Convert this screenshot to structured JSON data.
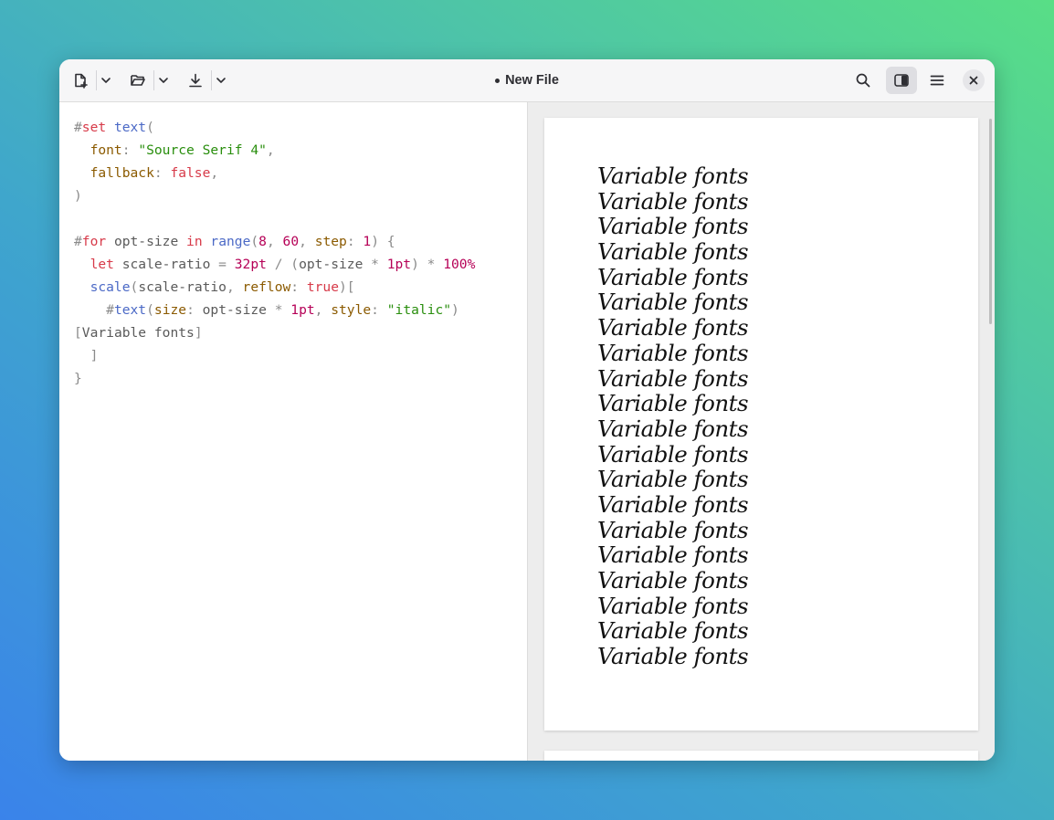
{
  "window": {
    "title": "New File",
    "unsaved_indicator": true
  },
  "toolbar": {
    "left_buttons": [
      {
        "icon": "new-file-icon"
      },
      {
        "icon": "chevron-down-icon"
      },
      {
        "icon": "open-folder-icon"
      },
      {
        "icon": "chevron-down-icon"
      },
      {
        "icon": "download-icon"
      },
      {
        "icon": "chevron-down-icon"
      }
    ],
    "right_buttons": [
      {
        "icon": "search-icon"
      },
      {
        "icon": "split-view-icon",
        "active": true
      },
      {
        "icon": "hamburger-menu-icon"
      },
      {
        "icon": "close-icon"
      }
    ]
  },
  "editor": {
    "lines": [
      [
        [
          "hash",
          "#"
        ],
        [
          "kw",
          "set"
        ],
        [
          "sp",
          " "
        ],
        [
          "fn",
          "text"
        ],
        [
          "punc",
          "("
        ]
      ],
      [
        [
          "sp",
          "  "
        ],
        [
          "arg",
          "font"
        ],
        [
          "punc",
          ": "
        ],
        [
          "str",
          "\"Source Serif 4\""
        ],
        [
          "punc",
          ","
        ]
      ],
      [
        [
          "sp",
          "  "
        ],
        [
          "arg",
          "fallback"
        ],
        [
          "punc",
          ": "
        ],
        [
          "kw",
          "false"
        ],
        [
          "punc",
          ","
        ]
      ],
      [
        [
          "punc",
          ")"
        ]
      ],
      [],
      [
        [
          "hash",
          "#"
        ],
        [
          "kw",
          "for"
        ],
        [
          "sp",
          " "
        ],
        [
          "var",
          "opt-size"
        ],
        [
          "sp",
          " "
        ],
        [
          "kw",
          "in"
        ],
        [
          "sp",
          " "
        ],
        [
          "fn",
          "range"
        ],
        [
          "punc",
          "("
        ],
        [
          "num",
          "8"
        ],
        [
          "punc",
          ", "
        ],
        [
          "num",
          "60"
        ],
        [
          "punc",
          ", "
        ],
        [
          "arg",
          "step"
        ],
        [
          "punc",
          ": "
        ],
        [
          "num",
          "1"
        ],
        [
          "punc",
          ") {"
        ]
      ],
      [
        [
          "sp",
          "  "
        ],
        [
          "kw",
          "let"
        ],
        [
          "sp",
          " "
        ],
        [
          "var",
          "scale-ratio"
        ],
        [
          "punc",
          " = "
        ],
        [
          "num",
          "32pt"
        ],
        [
          "punc",
          " / ("
        ],
        [
          "var",
          "opt-size"
        ],
        [
          "punc",
          " * "
        ],
        [
          "num",
          "1pt"
        ],
        [
          "punc",
          ") * "
        ],
        [
          "num",
          "100%"
        ]
      ],
      [
        [
          "sp",
          "  "
        ],
        [
          "fn",
          "scale"
        ],
        [
          "punc",
          "("
        ],
        [
          "var",
          "scale-ratio"
        ],
        [
          "punc",
          ", "
        ],
        [
          "arg",
          "reflow"
        ],
        [
          "punc",
          ": "
        ],
        [
          "kw",
          "true"
        ],
        [
          "punc",
          ")["
        ]
      ],
      [
        [
          "sp",
          "    "
        ],
        [
          "hash",
          "#"
        ],
        [
          "fn",
          "text"
        ],
        [
          "punc",
          "("
        ],
        [
          "arg",
          "size"
        ],
        [
          "punc",
          ": "
        ],
        [
          "var",
          "opt-size"
        ],
        [
          "punc",
          " * "
        ],
        [
          "num",
          "1pt"
        ],
        [
          "punc",
          ", "
        ],
        [
          "arg",
          "style"
        ],
        [
          "punc",
          ": "
        ],
        [
          "str",
          "\"italic\""
        ],
        [
          "punc",
          ")"
        ]
      ],
      [
        [
          "punc",
          "["
        ],
        [
          "var",
          "Variable fonts"
        ],
        [
          "punc",
          "]"
        ]
      ],
      [
        [
          "sp",
          "  "
        ],
        [
          "punc",
          "]"
        ]
      ],
      [
        [
          "punc",
          "}"
        ]
      ]
    ]
  },
  "preview": {
    "lines": [
      "Variable fonts",
      "Variable fonts",
      "Variable fonts",
      "Variable fonts",
      "Variable fonts",
      "Variable fonts",
      "Variable fonts",
      "Variable fonts",
      "Variable fonts",
      "Variable fonts",
      "Variable fonts",
      "Variable fonts",
      "Variable fonts",
      "Variable fonts",
      "Variable fonts",
      "Variable fonts",
      "Variable fonts",
      "Variable fonts",
      "Variable fonts",
      "Variable fonts"
    ]
  }
}
